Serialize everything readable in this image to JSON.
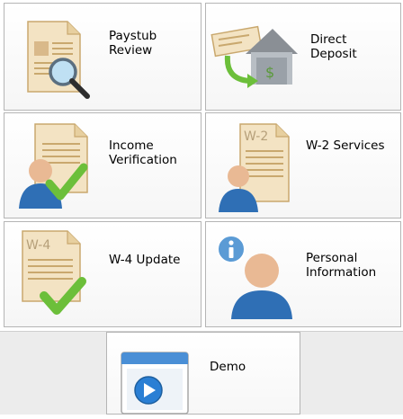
{
  "tiles": {
    "paystub": {
      "label": "Paystub\nReview",
      "icon": "paystub-magnifier-icon"
    },
    "direct_deposit": {
      "label": "Direct\nDeposit",
      "icon": "check-to-bank-icon"
    },
    "income": {
      "label": "Income\nVerification",
      "icon": "user-document-check-icon"
    },
    "w2": {
      "label": "W-2 Services",
      "icon": "w2-form-user-icon"
    },
    "w4": {
      "label": "W-4 Update",
      "icon": "w4-form-check-icon"
    },
    "personal": {
      "label": "Personal\nInformation",
      "icon": "user-info-icon"
    },
    "demo": {
      "label": "Demo",
      "icon": "video-play-icon"
    }
  },
  "forms": {
    "w2_tag": "W-2",
    "w4_tag": "W-4"
  },
  "colors": {
    "tile_border": "#b5b5b5",
    "check_green": "#6cbf3a",
    "person_blue": "#2f6fb5",
    "paper": "#f3e3c3",
    "play_blue": "#2a7fd4"
  }
}
